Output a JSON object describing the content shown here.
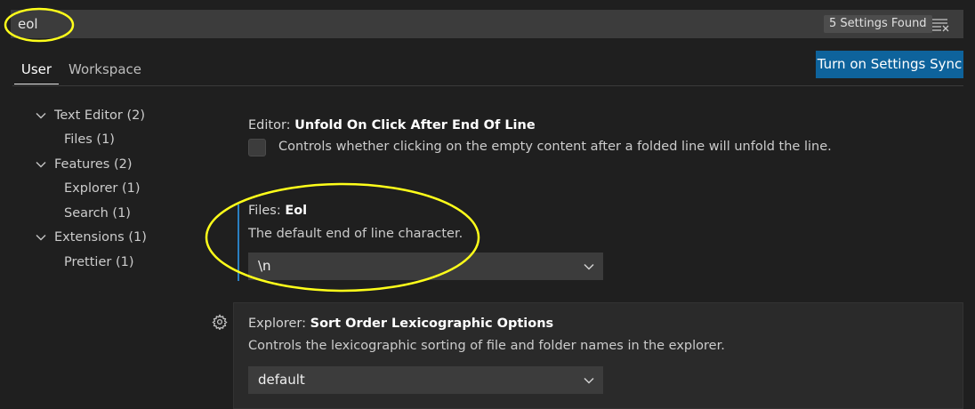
{
  "search": {
    "value": "eol",
    "found_label": "5 Settings Found"
  },
  "tabs": [
    {
      "label": "User"
    },
    {
      "label": "Workspace"
    }
  ],
  "sync_button": {
    "label": "Turn on Settings Sync"
  },
  "toc": [
    {
      "label": "Text Editor (2)",
      "expanded": true
    },
    {
      "label": "Files (1)"
    },
    {
      "label": "Features (2)",
      "expanded": true
    },
    {
      "label": "Explorer (1)"
    },
    {
      "label": "Search (1)"
    },
    {
      "label": "Extensions (1)",
      "expanded": true
    },
    {
      "label": "Prettier (1)"
    }
  ],
  "settings": [
    {
      "category": "Editor: ",
      "name": "Unfold On Click After End Of Line",
      "description": "Controls whether clicking on the empty content after a folded line will unfold the line.",
      "checked": false
    },
    {
      "category": "Files: ",
      "name": "Eol",
      "description": "The default end of line character.",
      "value": "\\n"
    },
    {
      "category": "Explorer: ",
      "name": "Sort Order Lexicographic Options",
      "description": "Controls the lexicographic sorting of file and folder names in the explorer.",
      "value": "default"
    }
  ],
  "colors": {
    "annotation": "#ffff1a",
    "accent": "#0e639c",
    "modified_bar": "#2a7fc1"
  },
  "icons": [
    "clear-filter-icon",
    "chevron-down-icon",
    "gear-icon"
  ]
}
